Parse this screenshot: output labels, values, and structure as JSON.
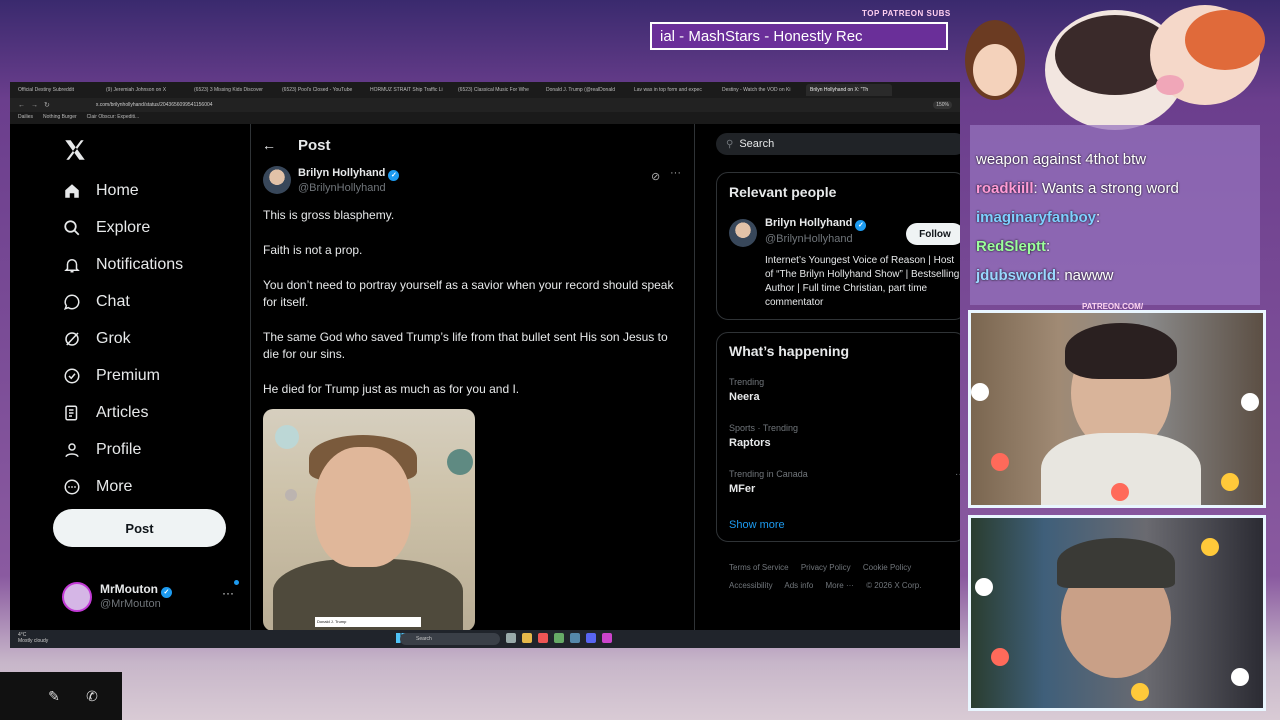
{
  "stream": {
    "top_label": "TOP PATREON SUBS",
    "ticker": "ial - MashStars - Honestly Rec",
    "patreon_label": "PATREON.COM/"
  },
  "browser": {
    "tabs": [
      {
        "label": "Official Destiny Subreddit"
      },
      {
        "label": "(9) Jeremiah Johnson on X"
      },
      {
        "label": "(6523) 3 Missing Kids Discover"
      },
      {
        "label": "(6523) Pool's Closed - YouTube"
      },
      {
        "label": "HORMUZ STRAIT Ship Traffic Li"
      },
      {
        "label": "(6523) Classical Music For Whe"
      },
      {
        "label": "Donald J. Trump (@realDonald"
      },
      {
        "label": "Lav was in top form and expec"
      },
      {
        "label": "Destiny - Watch the VOD on Ki"
      },
      {
        "label": "Brilyn Hollyhand on X: \"Th",
        "active": true
      }
    ],
    "url": "x.com/brilynhollyhand/status/2043656099541156004",
    "zoom": "150%",
    "bookmarks": [
      "Dailies",
      "Nothing Burger",
      "Clair Obscur: Expediti..."
    ]
  },
  "sidebar": {
    "items": [
      {
        "label": "Home",
        "icon": "home-icon"
      },
      {
        "label": "Explore",
        "icon": "search-icon"
      },
      {
        "label": "Notifications",
        "icon": "bell-icon"
      },
      {
        "label": "Chat",
        "icon": "chat-icon"
      },
      {
        "label": "Grok",
        "icon": "grok-icon"
      },
      {
        "label": "Premium",
        "icon": "verified-icon"
      },
      {
        "label": "Articles",
        "icon": "article-icon"
      },
      {
        "label": "Profile",
        "icon": "person-icon"
      },
      {
        "label": "More",
        "icon": "more-circle-icon"
      }
    ],
    "post_button": "Post",
    "account": {
      "name": "MrMouton",
      "handle": "@MrMouton"
    }
  },
  "post": {
    "header": "Post",
    "author_name": "Brilyn Hollyhand",
    "author_handle": "@BrilynHollyhand",
    "paragraphs": [
      "This is gross blasphemy.",
      "Faith is not a prop.",
      "You don’t need to portray yourself as a savior when your record should speak for itself.",
      "The same God who saved Trump’s life from that bullet sent His son Jesus to die for our sins.",
      "He died for Trump just as much as for you and I."
    ],
    "video_caption": "Donald J. Trump"
  },
  "right": {
    "search_placeholder": "Search",
    "relevant_title": "Relevant people",
    "person": {
      "name": "Brilyn Hollyhand",
      "handle": "@BrilynHollyhand",
      "follow": "Follow",
      "bio": "Internet’s Youngest Voice of Reason | Host of “The Brilyn Hollyhand Show” | Bestselling Author | Full time Christian, part time commentator"
    },
    "happening_title": "What’s happening",
    "trends": [
      {
        "context": "Trending",
        "name": "Neera"
      },
      {
        "context": "Sports · Trending",
        "name": "Raptors"
      },
      {
        "context": "Trending in Canada",
        "name": "MFer"
      }
    ],
    "show_more": "Show more",
    "footer": [
      "Terms of Service",
      "Privacy Policy",
      "Cookie Policy",
      "Accessibility",
      "Ads info",
      "More ···",
      "© 2026 X Corp."
    ]
  },
  "taskbar": {
    "weather_temp": "4°C",
    "weather_desc": "Mostly cloudy",
    "search": "Search"
  },
  "chat": [
    {
      "user": "",
      "text": "weapon against 4thot btw"
    },
    {
      "user": "roadkiill",
      "text": ": Wants a strong word",
      "color": "#ff9bd6"
    },
    {
      "user": "imaginaryfanboy",
      "text": ":",
      "color": "#7fd0ff"
    },
    {
      "user": "RedSleptt",
      "text": ":",
      "color": "#9bff9b"
    },
    {
      "user": "jdubsworld",
      "text": ": nawww",
      "color": "#9ad8ff"
    }
  ]
}
